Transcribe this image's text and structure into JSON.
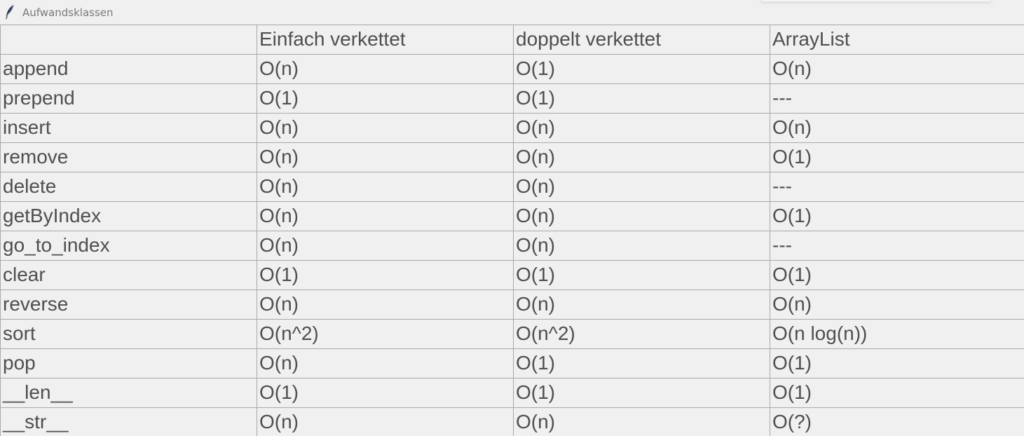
{
  "window": {
    "title": "Aufwandsklassen",
    "icon": "feather-icon"
  },
  "table": {
    "headers": [
      "",
      "Einfach verkettet",
      "doppelt verkettet",
      "ArrayList"
    ],
    "rows": [
      [
        "append",
        "O(n)",
        "O(1)",
        "O(n)"
      ],
      [
        "prepend",
        "O(1)",
        "O(1)",
        "---"
      ],
      [
        "insert",
        "O(n)",
        "O(n)",
        "O(n)"
      ],
      [
        "remove",
        "O(n)",
        "O(n)",
        "O(1)"
      ],
      [
        "delete",
        "O(n)",
        "O(n)",
        "---"
      ],
      [
        "getByIndex",
        "O(n)",
        "O(n)",
        "O(1)"
      ],
      [
        "go_to_index",
        "O(n)",
        "O(n)",
        "---"
      ],
      [
        "clear",
        "O(1)",
        "O(1)",
        "O(1)"
      ],
      [
        "reverse",
        "O(n)",
        "O(n)",
        "O(n)"
      ],
      [
        "sort",
        "O(n^2)",
        "O(n^2)",
        "O(n log(n))"
      ],
      [
        "pop",
        "O(n)",
        "O(1)",
        "O(1)"
      ],
      [
        "__len__",
        "O(1)",
        "O(1)",
        "O(1)"
      ],
      [
        "__str__",
        "O(n)",
        "O(n)",
        "O(?)"
      ]
    ]
  }
}
